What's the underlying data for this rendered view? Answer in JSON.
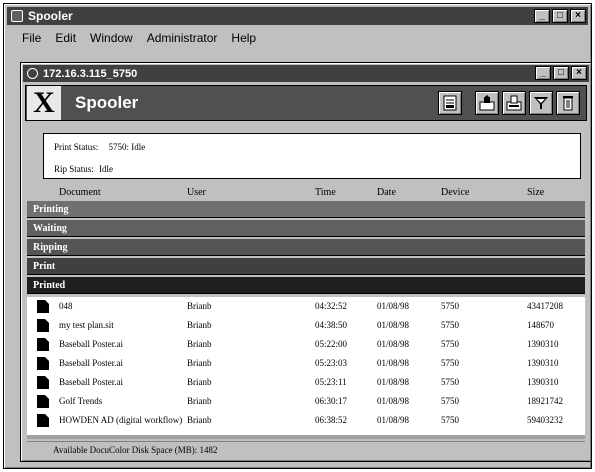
{
  "app": {
    "title": "Spooler"
  },
  "window_buttons": {
    "minimize": "_",
    "maximize": "□",
    "close": "×"
  },
  "menu": [
    {
      "label": "File"
    },
    {
      "label": "Edit"
    },
    {
      "label": "Window"
    },
    {
      "label": "Administrator"
    },
    {
      "label": "Help"
    }
  ],
  "child_window": {
    "title": "172.16.3.115_5750"
  },
  "banner": {
    "logo": "X",
    "title": "Spooler"
  },
  "toolbar": [
    {
      "icon": "printer-settings-icon"
    },
    {
      "icon": "queue-up-icon"
    },
    {
      "icon": "queue-print-icon"
    },
    {
      "icon": "funnel-icon"
    },
    {
      "icon": "trash-icon"
    }
  ],
  "status": {
    "print_label": "Print Status:",
    "print_value": "5750: Idle",
    "rip_label": "Rip Status:",
    "rip_value": "Idle"
  },
  "columns": [
    "Document",
    "User",
    "Time",
    "Date",
    "Device",
    "Size"
  ],
  "groups": [
    {
      "label": "Printing",
      "color": "#707070"
    },
    {
      "label": "Waiting",
      "color": "#606060"
    },
    {
      "label": "Ripping",
      "color": "#555555"
    },
    {
      "label": "Print",
      "color": "#404040"
    },
    {
      "label": "Printed",
      "color": "#202020"
    }
  ],
  "rows": [
    {
      "document": "048",
      "user": "Brianb",
      "time": "04:32:52",
      "date": "01/08/98",
      "device": "5750",
      "size": "43417208"
    },
    {
      "document": "my test plan.sit",
      "user": "Brianb",
      "time": "04:38:50",
      "date": "01/08/98",
      "device": "5750",
      "size": "148670"
    },
    {
      "document": "Baseball Poster.ai",
      "user": "Brianb",
      "time": "05:22:00",
      "date": "01/08/98",
      "device": "5750",
      "size": "1390310"
    },
    {
      "document": "Baseball Poster.ai",
      "user": "Brianb",
      "time": "05:23:03",
      "date": "01/08/98",
      "device": "5750",
      "size": "1390310"
    },
    {
      "document": "Baseball Poster.ai",
      "user": "Brianb",
      "time": "05:23:11",
      "date": "01/08/98",
      "device": "5750",
      "size": "1390310"
    },
    {
      "document": "Golf Trends",
      "user": "Brianb",
      "time": "06:30:17",
      "date": "01/08/98",
      "device": "5750",
      "size": "18921742"
    },
    {
      "document": "HOWDEN AD (digital workflow)",
      "user": "Brianb",
      "time": "06:38:52",
      "date": "01/08/98",
      "device": "5750",
      "size": "59403232"
    }
  ],
  "statusbar": {
    "text": "Available DocuColor Disk Space (MB): 1482"
  }
}
